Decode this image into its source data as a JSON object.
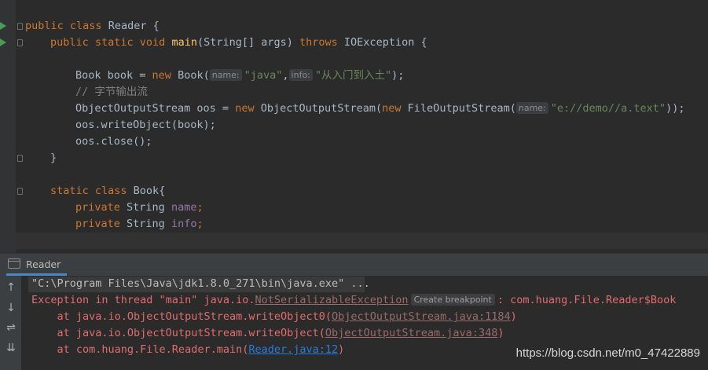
{
  "editor": {
    "line1": {
      "kw1": "public",
      "kw2": "class",
      "name": "Reader {"
    },
    "line2": {
      "kw": "public static void",
      "method": "main",
      "params": "(String[] args) ",
      "throws_kw": "throws",
      "rest": " IOException {"
    },
    "line4": {
      "prefix": "Book book = ",
      "new_kw": "new",
      "ctor": " Book(",
      "hint1": "name:",
      "arg1": "\"java\"",
      "comma": ",",
      "hint2": "info:",
      "arg2": "\"从入门到入土\"",
      "end": ");"
    },
    "line5": {
      "comment": "// 字节输出流"
    },
    "line6": {
      "prefix": "ObjectOutputStream oos = ",
      "new_kw": "new",
      "mid": " ObjectOutputStream(",
      "new_kw2": "new",
      "mid2": " FileOutputStream(",
      "hint": "name:",
      "arg": "\"e://demo//a.text\"",
      "end": "));"
    },
    "line7": {
      "text": "oos.writeObject(book);"
    },
    "line8": {
      "text": "oos.close();"
    },
    "line9": {
      "text": "}"
    },
    "line11": {
      "kw": "static class",
      "name": " Book{"
    },
    "line12": {
      "kw": "private",
      "type": " String ",
      "field": "name",
      ";": ";"
    },
    "line13": {
      "kw": "private",
      "type": " String ",
      "field": "info",
      ";": ";"
    }
  },
  "run_panel": {
    "tab_label": "Reader",
    "console": {
      "cmd": "\"C:\\Program Files\\Java\\jdk1.8.0_271\\bin\\java.exe\" ...",
      "exception_prefix": "Exception in thread \"main\" java.io.",
      "exception_class": "NotSerializableException",
      "breakpoint_hint": "Create breakpoint",
      "exception_suffix": ": com.huang.File.Reader$Book",
      "trace1_prefix": "    at java.io.ObjectOutputStream.writeObject0(",
      "trace1_link": "ObjectOutputStream.java:1184",
      "trace2_prefix": "    at java.io.ObjectOutputStream.writeObject(",
      "trace2_link": "ObjectOutputStream.java:348",
      "trace3_prefix": "    at com.huang.File.Reader.main(",
      "trace3_link": "Reader.java:12",
      "close_paren": ")"
    }
  },
  "watermark": "https://blog.csdn.net/m0_47422889",
  "icons": [
    "run-gutter-icon",
    "fold-icon",
    "console-tab-icon",
    "arrow-up-icon",
    "arrow-down-icon",
    "soft-wrap-icon",
    "scroll-to-end-icon"
  ],
  "colors": {
    "background": "#2b2b2b",
    "keyword": "#cc7832",
    "string": "#6a8759",
    "method": "#ffc66d",
    "field": "#9876aa",
    "error": "#e06c6c",
    "link": "#287bde"
  }
}
